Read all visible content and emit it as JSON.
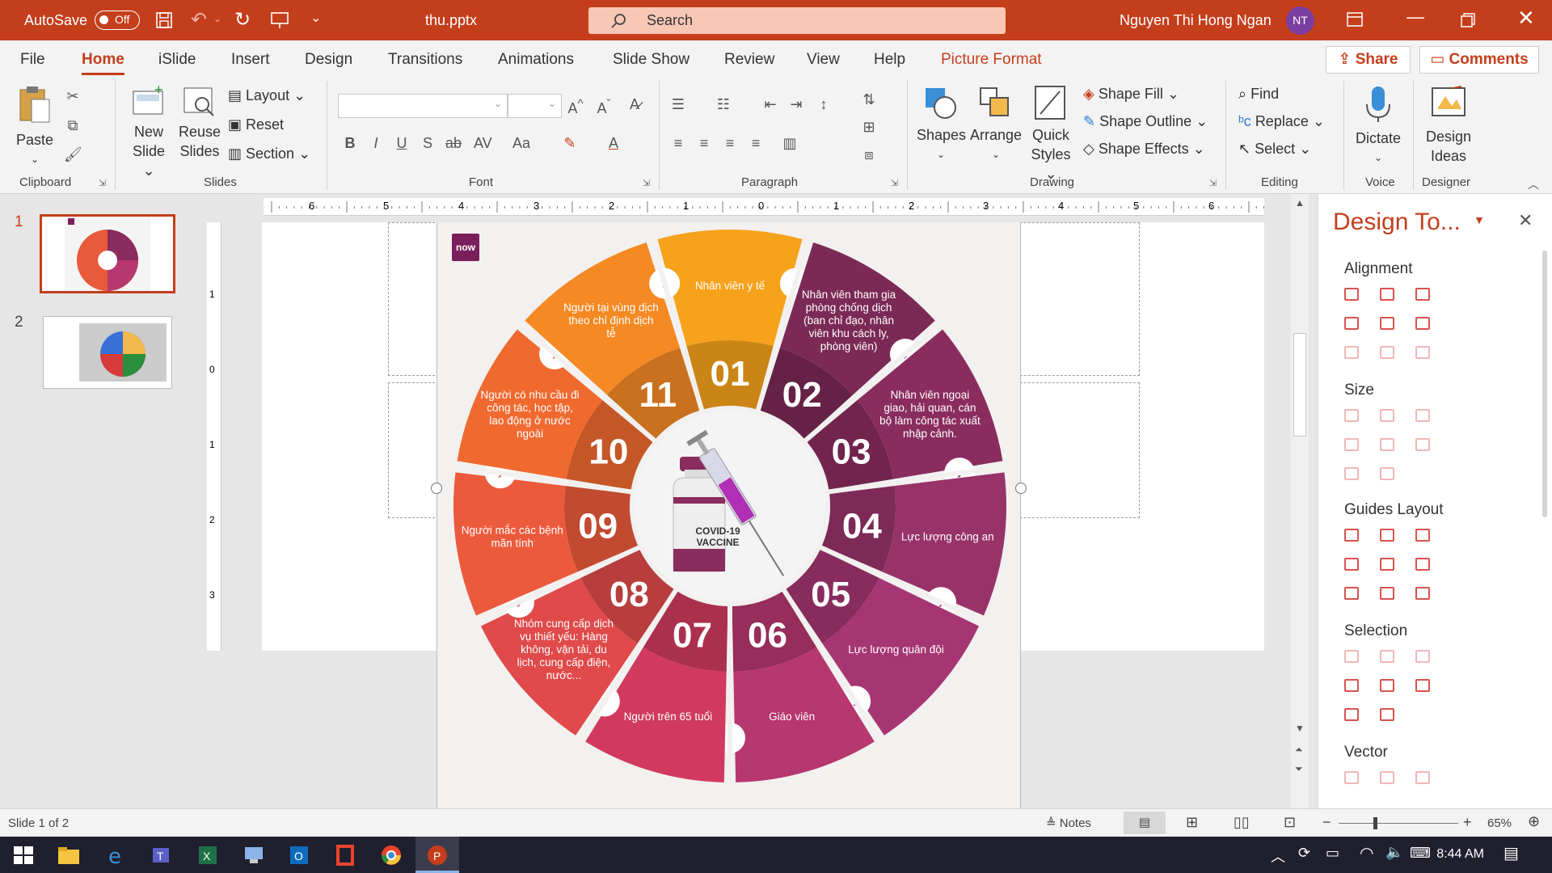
{
  "titlebar": {
    "autosave_label": "AutoSave",
    "autosave_state": "Off",
    "filename": "thu.pptx",
    "search_placeholder": "Search",
    "user_name": "Nguyen Thi Hong Ngan",
    "user_initials": "NT"
  },
  "menu_tabs": [
    "File",
    "Home",
    "iSlide",
    "Insert",
    "Design",
    "Transitions",
    "Animations",
    "Slide Show",
    "Review",
    "View",
    "Help",
    "Picture Format"
  ],
  "share_label": "Share",
  "comments_label": "Comments",
  "ribbon": {
    "clipboard": {
      "paste": "Paste",
      "label": "Clipboard"
    },
    "slides": {
      "new_slide_1": "New",
      "new_slide_2": "Slide",
      "reuse_1": "Reuse",
      "reuse_2": "Slides",
      "layout": "Layout",
      "reset": "Reset",
      "section": "Section",
      "label": "Slides"
    },
    "font": {
      "label": "Font"
    },
    "paragraph": {
      "label": "Paragraph"
    },
    "drawing": {
      "shapes": "Shapes",
      "arrange": "Arrange",
      "quick_1": "Quick",
      "quick_2": "Styles",
      "fill": "Shape Fill",
      "outline": "Shape Outline",
      "effects": "Shape Effects",
      "label": "Drawing"
    },
    "editing": {
      "find": "Find",
      "replace": "Replace",
      "select": "Select",
      "label": "Editing"
    },
    "voice": {
      "dictate": "Dictate",
      "label": "Voice"
    },
    "designer": {
      "ideas_1": "Design",
      "ideas_2": "Ideas",
      "label": "Designer"
    }
  },
  "thumbs": {
    "n1": "1",
    "n2": "2"
  },
  "ruler_h": [
    "6",
    "5",
    "4",
    "3",
    "2",
    "1",
    "0",
    "1",
    "2",
    "3",
    "4",
    "5",
    "6"
  ],
  "ruler_v": [
    "1",
    "0",
    "1",
    "2",
    "3"
  ],
  "infographic": {
    "logo": "now",
    "center": "COVID-19 VACCINE",
    "segments": [
      {
        "num": "01",
        "text": "Nhân viên y tế",
        "color": "#f7a21b"
      },
      {
        "num": "02",
        "text": "Nhân viên tham gia phòng chống dịch (ban chỉ đạo, nhân viên khu cách ly, phòng viên)",
        "color": "#7b2a55"
      },
      {
        "num": "03",
        "text": "Nhân viên ngoại giao, hải quan, cán bộ làm công tác xuất nhập cảnh.",
        "color": "#8a2d5e"
      },
      {
        "num": "04",
        "text": "Lực lượng công an",
        "color": "#98336a"
      },
      {
        "num": "05",
        "text": "Lực lượng quân đội",
        "color": "#a63673"
      },
      {
        "num": "06",
        "text": "Giáo viên",
        "color": "#b7376f"
      },
      {
        "num": "07",
        "text": "Người trên 65 tuổi",
        "color": "#d13a5e"
      },
      {
        "num": "08",
        "text": "Nhóm cung cấp dịch vụ thiết yếu: Hàng không, vận tải, du lịch, cung cấp điện, nước...",
        "color": "#e04a4a"
      },
      {
        "num": "09",
        "text": "Người mắc các bệnh mãn tính",
        "color": "#ec5a3c"
      },
      {
        "num": "10",
        "text": "Người có nhu cầu đi công tác, học tập, lao động ở nước ngoài",
        "color": "#f06a30"
      },
      {
        "num": "11",
        "text": "Người tại vùng dịch theo chỉ định dịch tễ",
        "color": "#f58a24"
      }
    ]
  },
  "design_pane": {
    "title": "Design To...",
    "sections": [
      "Alignment",
      "Size",
      "Guides Layout",
      "Selection",
      "Vector"
    ]
  },
  "status": {
    "slide_info": "Slide 1 of 2",
    "notes": "Notes",
    "zoom": "65%"
  },
  "taskbar": {
    "time": "8:44 AM"
  },
  "colors": {
    "accent": "#c43e1c",
    "taskbar": "#1f1f2e"
  }
}
